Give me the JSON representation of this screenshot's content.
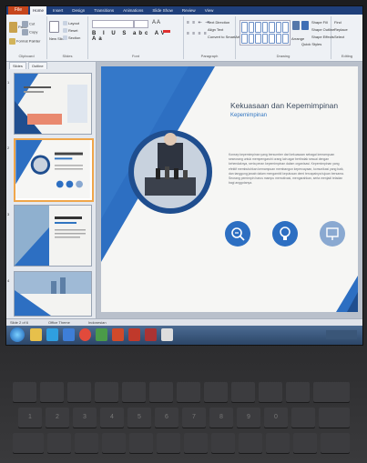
{
  "ribbon_tabs": [
    "File",
    "Home",
    "Insert",
    "Design",
    "Transitions",
    "Animations",
    "Slide Show",
    "Review",
    "View"
  ],
  "ribbon_groups": {
    "clipboard": {
      "label": "Clipboard",
      "cut": "Cut",
      "copy": "Copy",
      "paste": "Paste",
      "format_painter": "Format Painter"
    },
    "slides": {
      "label": "Slides",
      "new_slide": "New Slide",
      "layout": "Layout",
      "reset": "Reset",
      "section": "Section"
    },
    "font": {
      "label": "Font"
    },
    "paragraph": {
      "label": "Paragraph",
      "text_direction": "Text Direction",
      "align_text": "Align Text",
      "convert_smartart": "Convert to SmartArt"
    },
    "drawing": {
      "label": "Drawing",
      "arrange": "Arrange",
      "quick_styles": "Quick Styles",
      "shape_fill": "Shape Fill",
      "shape_outline": "Shape Outline",
      "shape_effects": "Shape Effects"
    },
    "editing": {
      "label": "Editing",
      "find": "Find",
      "replace": "Replace",
      "select": "Select"
    }
  },
  "left_pane_tabs": [
    "Slides",
    "Outline"
  ],
  "slide": {
    "title": "Kekuasaan dan Kepemimpinan",
    "subtitle": "Kepemimpinan",
    "body": "Konsep kepemimpinan yang bersumber dari kekuasaan sebagai kemampuan seseorang untuk mempengaruhi orang lain agar bertindak sesuai dengan kehendaknya, serta peran kepemimpinan dalam organisasi. Kepemimpinan yang efektif membutuhkan kemampuan membangun kepercayaan, komunikasi yang baik, dan tanggung jawab dalam mengambil keputusan demi tercapainya tujuan bersama. Seorang pemimpin harus mampu memotivasi, mengarahkan, serta menjadi teladan bagi anggotanya."
  },
  "status_tabs": [
    "Slide 2 of 6",
    "Office Theme",
    "Indonesian"
  ],
  "colors": {
    "accent_blue": "#2d6fc2",
    "dark_blue": "#1f4e8f",
    "file_tab": "#c6461c",
    "selection": "#f0a64a"
  },
  "icons": [
    "search-zoom-icon",
    "lightbulb-icon",
    "presentation-board-icon"
  ],
  "keyboard_keys": [
    "1",
    "2",
    "3",
    "4",
    "5",
    "6",
    "7",
    "8",
    "9",
    "0"
  ]
}
